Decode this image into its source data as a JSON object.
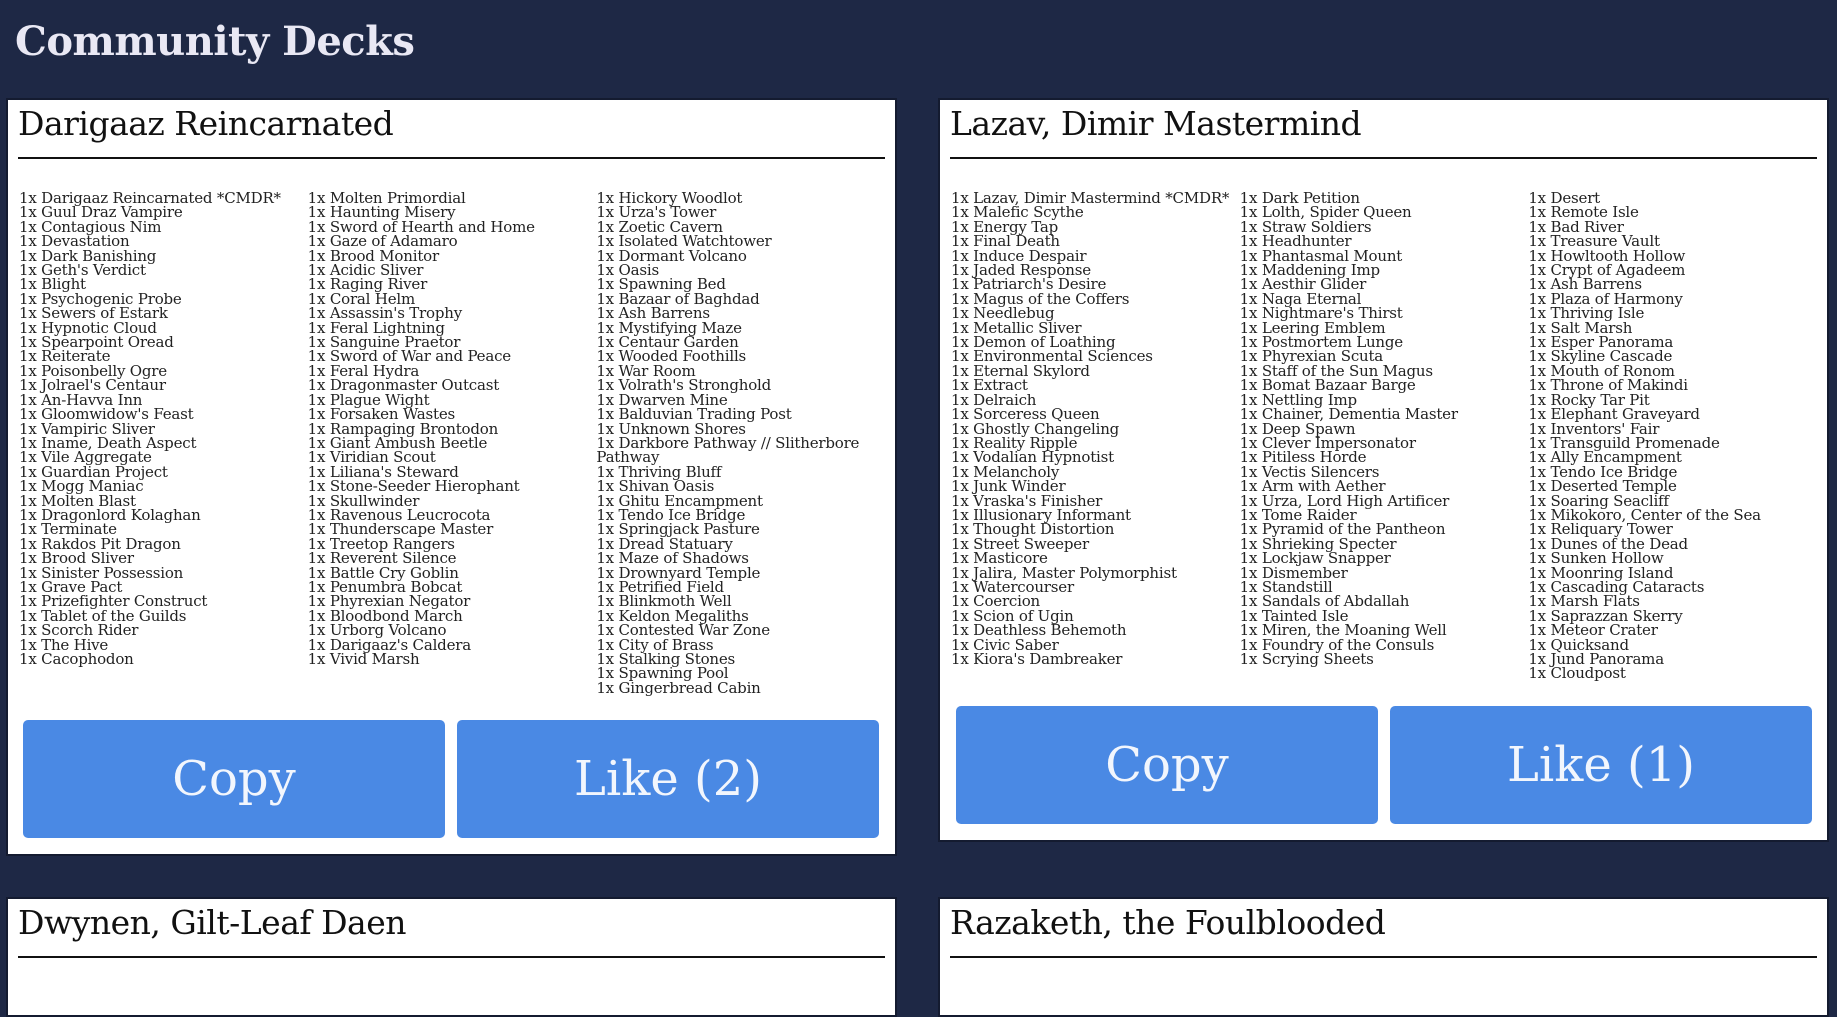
{
  "page": {
    "title": "Community Decks"
  },
  "decks": [
    {
      "name": "Darigaaz Reincarnated",
      "copy_label": "Copy",
      "like_label": "Like (2)",
      "columns": [
        [
          "1x Darigaaz Reincarnated *CMDR*",
          "1x Guul Draz Vampire",
          "1x Contagious Nim",
          "1x Devastation",
          "1x Dark Banishing",
          "1x Geth's Verdict",
          "1x Blight",
          "1x Psychogenic Probe",
          "1x Sewers of Estark",
          "1x Hypnotic Cloud",
          "1x Spearpoint Oread",
          "1x Reiterate",
          "1x Poisonbelly Ogre",
          "1x Jolrael's Centaur",
          "1x An-Havva Inn",
          "1x Gloomwidow's Feast",
          "1x Vampiric Sliver",
          "1x Iname, Death Aspect",
          "1x Vile Aggregate",
          "1x Guardian Project",
          "1x Mogg Maniac",
          "1x Molten Blast",
          "1x Dragonlord Kolaghan",
          "1x Terminate",
          "1x Rakdos Pit Dragon",
          "1x Brood Sliver",
          "1x Sinister Possession",
          "1x Grave Pact",
          "1x Prizefighter Construct",
          "1x Tablet of the Guilds",
          "1x Scorch Rider",
          "1x The Hive",
          "1x Cacophodon"
        ],
        [
          "1x Molten Primordial",
          "1x Haunting Misery",
          "1x Sword of Hearth and Home",
          "1x Gaze of Adamaro",
          "1x Brood Monitor",
          "1x Acidic Sliver",
          "1x Raging River",
          "1x Coral Helm",
          "1x Assassin's Trophy",
          "1x Feral Lightning",
          "1x Sanguine Praetor",
          "1x Sword of War and Peace",
          "1x Feral Hydra",
          "1x Dragonmaster Outcast",
          "1x Plague Wight",
          "1x Forsaken Wastes",
          "1x Rampaging Brontodon",
          "1x Giant Ambush Beetle",
          "1x Viridian Scout",
          "1x Liliana's Steward",
          "1x Stone-Seeder Hierophant",
          "1x Skullwinder",
          "1x Ravenous Leucrocota",
          "1x Thunderscape Master",
          "1x Treetop Rangers",
          "1x Reverent Silence",
          "1x Battle Cry Goblin",
          "1x Penumbra Bobcat",
          "1x Phyrexian Negator",
          "1x Bloodbond March",
          "1x Urborg Volcano",
          "1x Darigaaz's Caldera",
          "1x Vivid Marsh"
        ],
        [
          "1x Hickory Woodlot",
          "1x Urza's Tower",
          "1x Zoetic Cavern",
          "1x Isolated Watchtower",
          "1x Dormant Volcano",
          "1x Oasis",
          "1x Spawning Bed",
          "1x Bazaar of Baghdad",
          "1x Ash Barrens",
          "1x Mystifying Maze",
          "1x Centaur Garden",
          "1x Wooded Foothills",
          "1x War Room",
          "1x Volrath's Stronghold",
          "1x Dwarven Mine",
          "1x Balduvian Trading Post",
          "1x Unknown Shores",
          "1x Darkbore Pathway // Slitherbore Pathway",
          "1x Thriving Bluff",
          "1x Shivan Oasis",
          "1x Ghitu Encampment",
          "1x Tendo Ice Bridge",
          "1x Springjack Pasture",
          "1x Dread Statuary",
          "1x Maze of Shadows",
          "1x Drownyard Temple",
          "1x Petrified Field",
          "1x Blinkmoth Well",
          "1x Keldon Megaliths",
          "1x Contested War Zone",
          "1x City of Brass",
          "1x Stalking Stones",
          "1x Spawning Pool",
          "1x Gingerbread Cabin"
        ]
      ]
    },
    {
      "name": "Lazav, Dimir Mastermind",
      "copy_label": "Copy",
      "like_label": "Like (1)",
      "columns": [
        [
          "1x Lazav, Dimir Mastermind *CMDR*",
          "1x Malefic Scythe",
          "1x Energy Tap",
          "1x Final Death",
          "1x Induce Despair",
          "1x Jaded Response",
          "1x Patriarch's Desire",
          "1x Magus of the Coffers",
          "1x Needlebug",
          "1x Metallic Sliver",
          "1x Demon of Loathing",
          "1x Environmental Sciences",
          "1x Eternal Skylord",
          "1x Extract",
          "1x Delraich",
          "1x Sorceress Queen",
          "1x Ghostly Changeling",
          "1x Reality Ripple",
          "1x Vodalian Hypnotist",
          "1x Melancholy",
          "1x Junk Winder",
          "1x Vraska's Finisher",
          "1x Illusionary Informant",
          "1x Thought Distortion",
          "1x Street Sweeper",
          "1x Masticore",
          "1x Jalira, Master Polymorphist",
          "1x Watercourser",
          "1x Coercion",
          "1x Scion of Ugin",
          "1x Deathless Behemoth",
          "1x Civic Saber",
          "1x Kiora's Dambreaker"
        ],
        [
          "1x Dark Petition",
          "1x Lolth, Spider Queen",
          "1x Straw Soldiers",
          "1x Headhunter",
          "1x Phantasmal Mount",
          "1x Maddening Imp",
          "1x Aesthir Glider",
          "1x Naga Eternal",
          "1x Nightmare's Thirst",
          "1x Leering Emblem",
          "1x Postmortem Lunge",
          "1x Phyrexian Scuta",
          "1x Staff of the Sun Magus",
          "1x Bomat Bazaar Barge",
          "1x Nettling Imp",
          "1x Chainer, Dementia Master",
          "1x Deep Spawn",
          "1x Clever Impersonator",
          "1x Pitiless Horde",
          "1x Vectis Silencers",
          "1x Arm with Aether",
          "1x Urza, Lord High Artificer",
          "1x Tome Raider",
          "1x Pyramid of the Pantheon",
          "1x Shrieking Specter",
          "1x Lockjaw Snapper",
          "1x Dismember",
          "1x Standstill",
          "1x Sandals of Abdallah",
          "1x Tainted Isle",
          "1x Miren, the Moaning Well",
          "1x Foundry of the Consuls",
          "1x Scrying Sheets"
        ],
        [
          "1x Desert",
          "1x Remote Isle",
          "1x Bad River",
          "1x Treasure Vault",
          "1x Howltooth Hollow",
          "1x Crypt of Agadeem",
          "1x Ash Barrens",
          "1x Plaza of Harmony",
          "1x Thriving Isle",
          "1x Salt Marsh",
          "1x Esper Panorama",
          "1x Skyline Cascade",
          "1x Mouth of Ronom",
          "1x Throne of Makindi",
          "1x Rocky Tar Pit",
          "1x Elephant Graveyard",
          "1x Inventors' Fair",
          "1x Transguild Promenade",
          "1x Ally Encampment",
          "1x Tendo Ice Bridge",
          "1x Deserted Temple",
          "1x Soaring Seacliff",
          "1x Mikokoro, Center of the Sea",
          "1x Reliquary Tower",
          "1x Dunes of the Dead",
          "1x Sunken Hollow",
          "1x Moonring Island",
          "1x Cascading Cataracts",
          "1x Marsh Flats",
          "1x Saprazzan Skerry",
          "1x Meteor Crater",
          "1x Quicksand",
          "1x Jund Panorama",
          "1x Cloudpost"
        ]
      ]
    },
    {
      "name": "Dwynen, Gilt-Leaf Daen"
    },
    {
      "name": "Razaketh, the Foulblooded"
    }
  ]
}
